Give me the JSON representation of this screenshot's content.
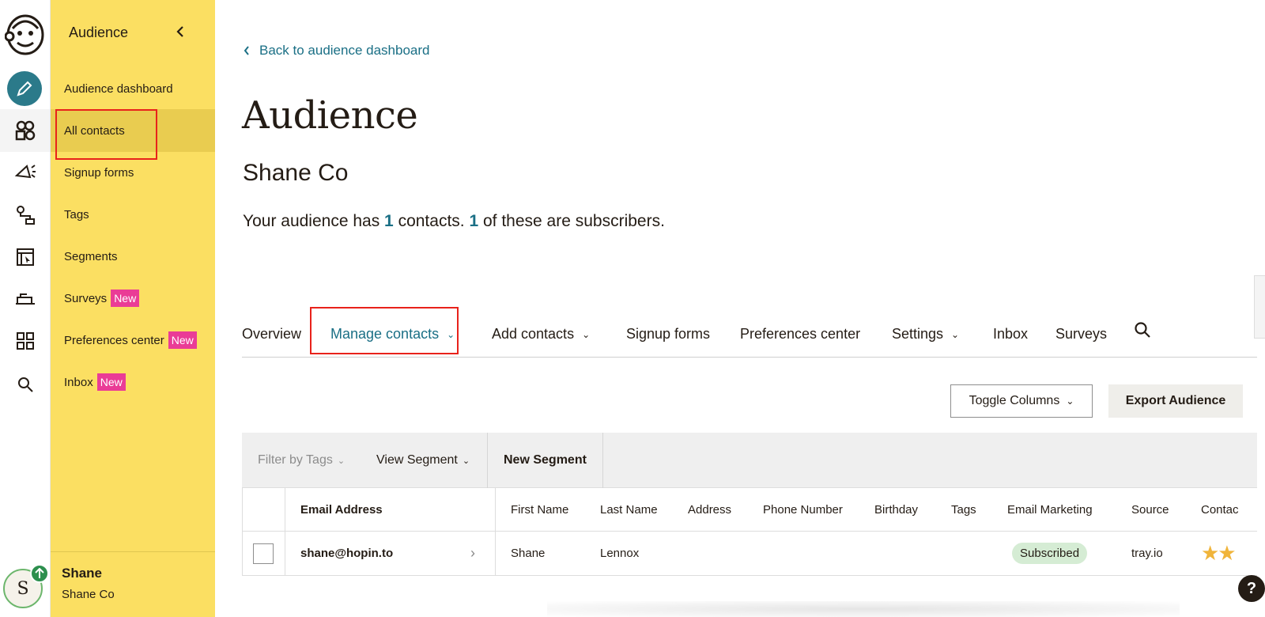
{
  "sidebar": {
    "heading": "Audience",
    "items": [
      {
        "label": "Audience dashboard"
      },
      {
        "label": "All contacts"
      },
      {
        "label": "Signup forms"
      },
      {
        "label": "Tags"
      },
      {
        "label": "Segments"
      },
      {
        "label": "Surveys",
        "badge": "New"
      },
      {
        "label": "Preferences center",
        "badge": "New"
      },
      {
        "label": "Inbox",
        "badge": "New"
      }
    ],
    "user": {
      "name": "Shane",
      "org": "Shane Co",
      "avatar_initial": "S"
    }
  },
  "rail": {
    "icons": [
      "mailchimp-logo-icon",
      "pencil-icon",
      "audience-icon",
      "megaphone-icon",
      "automation-icon",
      "website-icon",
      "integrations-icon",
      "grid-icon",
      "search-icon"
    ]
  },
  "main": {
    "back_link": "Back to audience dashboard",
    "title": "Audience",
    "audience_name": "Shane Co",
    "summary": {
      "prefix": "Your audience has ",
      "contacts": "1",
      "middle": " contacts. ",
      "subscribers": "1",
      "suffix": " of these are subscribers."
    },
    "tabs": [
      {
        "label": "Overview"
      },
      {
        "label": "Manage contacts",
        "dropdown": true,
        "active": true
      },
      {
        "label": "Add contacts",
        "dropdown": true
      },
      {
        "label": "Signup forms"
      },
      {
        "label": "Preferences center"
      },
      {
        "label": "Settings",
        "dropdown": true
      },
      {
        "label": "Inbox"
      },
      {
        "label": "Surveys"
      }
    ],
    "toggle_columns": "Toggle Columns",
    "export": "Export Audience",
    "filters": {
      "tags": "Filter by Tags",
      "segment": "View Segment",
      "new_segment": "New Segment"
    },
    "table": {
      "headers": [
        "Email Address",
        "First Name",
        "Last Name",
        "Address",
        "Phone Number",
        "Birthday",
        "Tags",
        "Email Marketing",
        "Source",
        "Contac"
      ],
      "rows": [
        {
          "email": "shane@hopin.to",
          "first": "Shane",
          "last": "Lennox",
          "address": "",
          "phone": "",
          "birthday": "",
          "tags": "",
          "marketing": "Subscribed",
          "source": "tray.io",
          "rating": "★★"
        }
      ]
    },
    "help": "?"
  },
  "colors": {
    "sidebar": "#fbdf62",
    "accent": "#1a6f85",
    "badge": "#ea3c96",
    "annotation": "#e8221b"
  }
}
